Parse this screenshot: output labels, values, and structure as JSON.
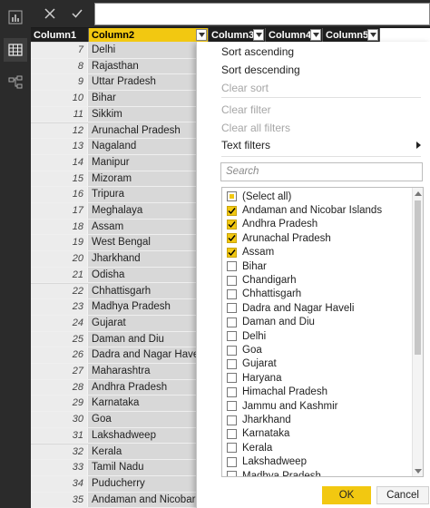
{
  "formula_bar": {
    "cancel_icon": "close-icon",
    "commit_icon": "check-icon",
    "value": ""
  },
  "left_rail": {
    "items": [
      {
        "name": "report-view",
        "icon": "bar-chart-icon"
      },
      {
        "name": "data-view",
        "icon": "table-icon"
      },
      {
        "name": "relationships-view",
        "icon": "relationships-icon"
      }
    ]
  },
  "columns": [
    "Column1",
    "Column2",
    "Column3",
    "Column4",
    "Column5"
  ],
  "rows": [
    {
      "num": "7",
      "value": "Delhi"
    },
    {
      "num": "8",
      "value": "Rajasthan"
    },
    {
      "num": "9",
      "value": "Uttar Pradesh"
    },
    {
      "num": "10",
      "value": "Bihar"
    },
    {
      "num": "11",
      "value": "Sikkim"
    },
    {
      "num": "12",
      "value": "Arunachal Pradesh"
    },
    {
      "num": "13",
      "value": "Nagaland"
    },
    {
      "num": "14",
      "value": "Manipur"
    },
    {
      "num": "15",
      "value": "Mizoram"
    },
    {
      "num": "16",
      "value": "Tripura"
    },
    {
      "num": "17",
      "value": "Meghalaya"
    },
    {
      "num": "18",
      "value": "Assam"
    },
    {
      "num": "19",
      "value": "West Bengal"
    },
    {
      "num": "20",
      "value": "Jharkhand"
    },
    {
      "num": "21",
      "value": "Odisha"
    },
    {
      "num": "22",
      "value": "Chhattisgarh"
    },
    {
      "num": "23",
      "value": "Madhya Pradesh"
    },
    {
      "num": "24",
      "value": "Gujarat"
    },
    {
      "num": "25",
      "value": "Daman and Diu"
    },
    {
      "num": "26",
      "value": "Dadra and Nagar Haveli"
    },
    {
      "num": "27",
      "value": "Maharashtra"
    },
    {
      "num": "28",
      "value": "Andhra Pradesh"
    },
    {
      "num": "29",
      "value": "Karnataka"
    },
    {
      "num": "30",
      "value": "Goa"
    },
    {
      "num": "31",
      "value": "Lakshadweep"
    },
    {
      "num": "32",
      "value": "Kerala"
    },
    {
      "num": "33",
      "value": "Tamil Nadu"
    },
    {
      "num": "34",
      "value": "Puducherry"
    },
    {
      "num": "35",
      "value": "Andaman and Nicobar Islar"
    }
  ],
  "menu": {
    "sort_ascending": "Sort ascending",
    "sort_descending": "Sort descending",
    "clear_sort": "Clear sort",
    "clear_filter": "Clear filter",
    "clear_all_filters": "Clear all filters",
    "text_filters": "Text filters",
    "search_placeholder": "Search"
  },
  "filter_values": [
    {
      "label": "(Select all)",
      "state": "partial"
    },
    {
      "label": "Andaman and Nicobar Islands",
      "state": "checked"
    },
    {
      "label": "Andhra Pradesh",
      "state": "checked"
    },
    {
      "label": "Arunachal Pradesh",
      "state": "checked"
    },
    {
      "label": "Assam",
      "state": "checked"
    },
    {
      "label": "Bihar",
      "state": "unchecked"
    },
    {
      "label": "Chandigarh",
      "state": "unchecked"
    },
    {
      "label": "Chhattisgarh",
      "state": "unchecked"
    },
    {
      "label": "Dadra and Nagar Haveli",
      "state": "unchecked"
    },
    {
      "label": "Daman and Diu",
      "state": "unchecked"
    },
    {
      "label": "Delhi",
      "state": "unchecked"
    },
    {
      "label": "Goa",
      "state": "unchecked"
    },
    {
      "label": "Gujarat",
      "state": "unchecked"
    },
    {
      "label": "Haryana",
      "state": "unchecked"
    },
    {
      "label": "Himachal Pradesh",
      "state": "unchecked"
    },
    {
      "label": "Jammu and Kashmir",
      "state": "unchecked"
    },
    {
      "label": "Jharkhand",
      "state": "unchecked"
    },
    {
      "label": "Karnataka",
      "state": "unchecked"
    },
    {
      "label": "Kerala",
      "state": "unchecked"
    },
    {
      "label": "Lakshadweep",
      "state": "unchecked"
    },
    {
      "label": "Madhya Pradesh",
      "state": "unchecked"
    }
  ],
  "buttons": {
    "ok": "OK",
    "cancel": "Cancel"
  },
  "colors": {
    "accent": "#f2c811",
    "rail": "#2b2b2b"
  }
}
